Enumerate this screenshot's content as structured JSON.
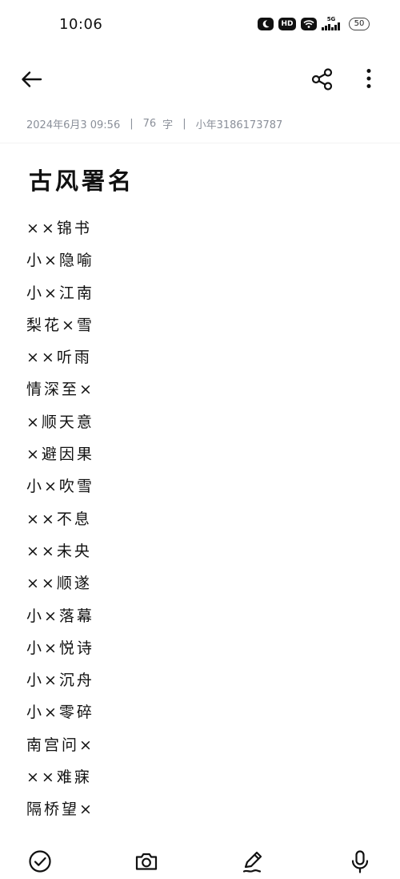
{
  "status_bar": {
    "time": "10:06",
    "hd_label": "HD",
    "network_label": "5G",
    "battery": "50"
  },
  "note": {
    "date": "2024年6月3 09:56",
    "char_count": "76",
    "char_unit": "字",
    "author": "小年3186173787",
    "separator": "|",
    "title": "古风署名",
    "lines": [
      "××锦书",
      "小×隐喻",
      "小×江南",
      "梨花×雪",
      "××听雨",
      "情深至×",
      "×顺天意",
      "×避因果",
      "小×吹雪",
      "××不息",
      "××未央",
      "××顺遂",
      "小×落幕",
      "小×悦诗",
      "小×沉舟",
      "小×零碎",
      "南宫问×",
      "××难寐",
      "隔桥望×"
    ]
  },
  "icons": {
    "back": "arrow-left-icon",
    "share": "share-icon",
    "more": "more-vertical-icon",
    "checklist": "check-circle-icon",
    "camera": "camera-icon",
    "pen": "pen-icon",
    "mic": "microphone-icon"
  }
}
